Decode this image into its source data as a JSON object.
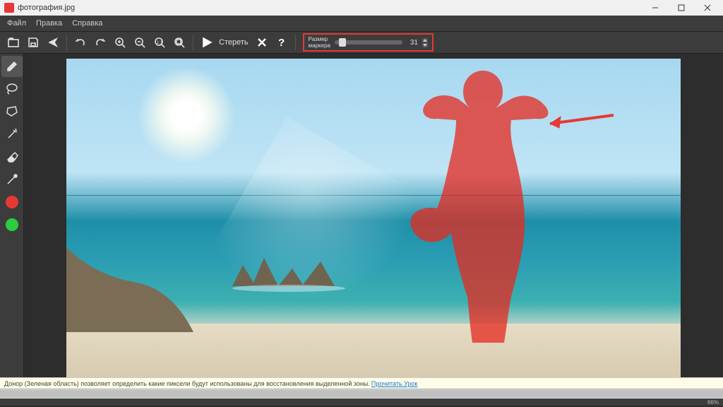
{
  "window": {
    "title": "фотография.jpg",
    "filename": "фотография.jpg"
  },
  "menu": {
    "file": "Файл",
    "edit": "Правка",
    "help": "Справка"
  },
  "toolbar": {
    "erase_label": "Стереть",
    "size_label_line1": "Размер",
    "size_label_line2": "маркера",
    "size_value": "31"
  },
  "hint": {
    "text": "Донор (Зеленая область) позволяет определить какие пиксели будут использованы для восстановления выделенной зоны.",
    "link": "Прочитать Урок"
  },
  "status": {
    "zoom": "66%"
  },
  "colors": {
    "accent_highlight": "#e53935",
    "mask": "rgba(230,40,30,0.75)",
    "donor": "#2ecc40"
  }
}
